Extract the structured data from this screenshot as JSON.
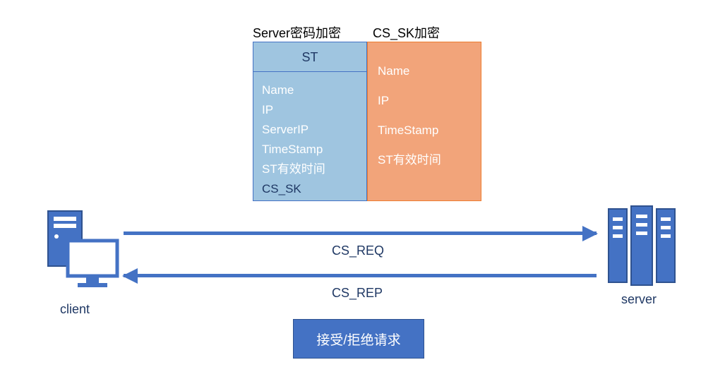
{
  "labels": {
    "server_enc": "Server密码加密",
    "cs_sk_enc": "CS_SK加密",
    "client": "client",
    "server": "server"
  },
  "bluebox": {
    "header": "ST",
    "fields": {
      "name": "Name",
      "ip": "IP",
      "serverip": "ServerIP",
      "timestamp": "TimeStamp",
      "st_valid": "ST有效时间",
      "cs_sk": "CS_SK"
    }
  },
  "orangebox": {
    "fields": {
      "name": "Name",
      "ip": "IP",
      "timestamp": "TimeStamp",
      "st_valid": "ST有效时间"
    }
  },
  "arrows": {
    "req": "CS_REQ",
    "rep": "CS_REP"
  },
  "response_box": "接受/拒绝请求",
  "colors": {
    "blue_fill": "#9FC5E0",
    "blue_stroke": "#4472C4",
    "orange_fill": "#F2A47A",
    "orange_stroke": "#ED7D31",
    "accent": "#4472C4"
  }
}
